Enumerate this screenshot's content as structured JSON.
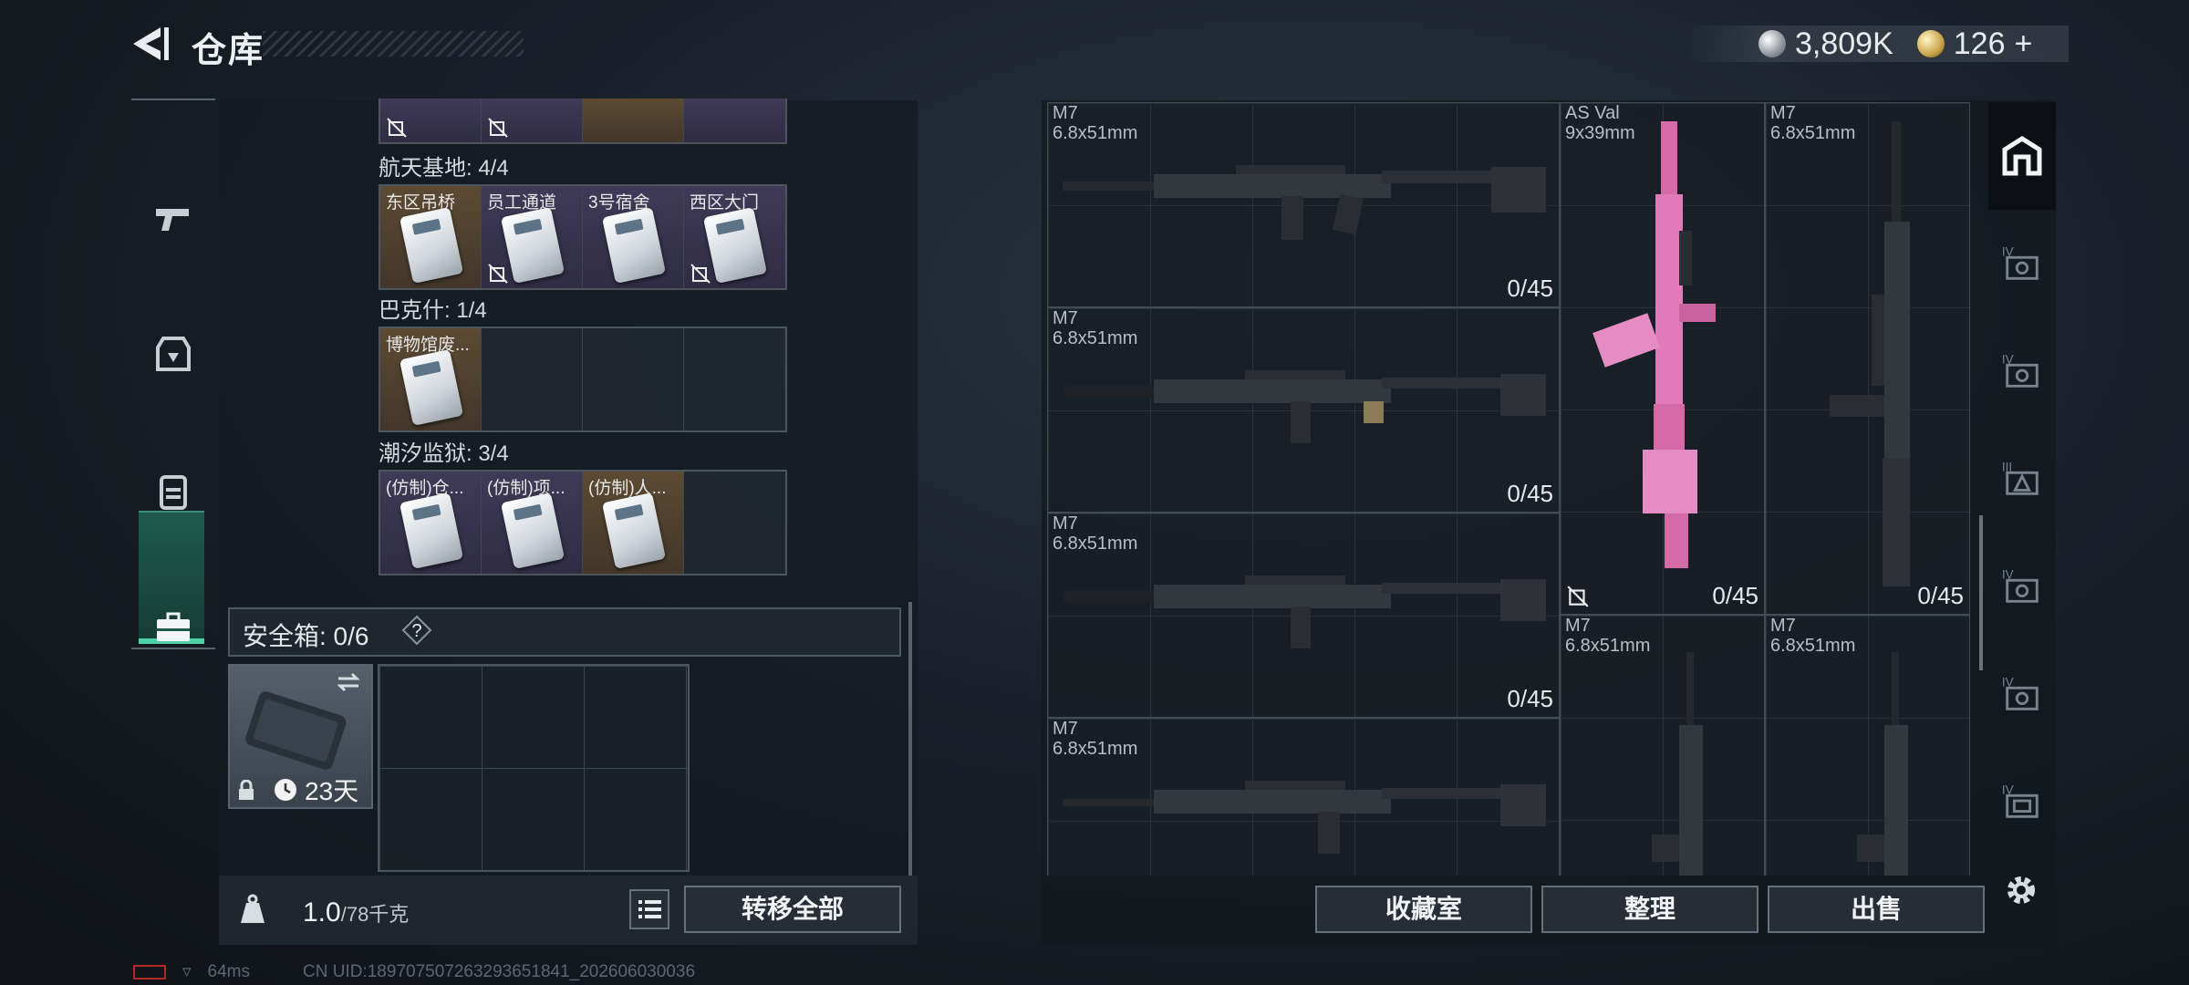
{
  "header": {
    "title": "仓库",
    "silver_amount": "3,809K",
    "gold_amount": "126",
    "gold_add": "+"
  },
  "left_panel": {
    "groups": [
      {
        "title": "航天基地: 4/4",
        "slots": [
          "东区吊桥",
          "员工通道",
          "3号宿舍",
          "西区大门"
        ]
      },
      {
        "title": "巴克什: 1/4",
        "slots": [
          "博物馆废..."
        ]
      },
      {
        "title": "潮汐监狱: 3/4",
        "slots": [
          "(仿制)仓...",
          "(仿制)项...",
          "(仿制)人..."
        ]
      }
    ],
    "safe_box": {
      "label": "安全箱: 0/6",
      "help": "?",
      "time": "23天"
    },
    "weight": {
      "current": "1.0",
      "max": "/78千克"
    },
    "transfer_all": "转移全部"
  },
  "right_panel": {
    "weapons": [
      {
        "name": "M7",
        "caliber": "6.8x51mm",
        "ammo": "0/45"
      },
      {
        "name": "M7",
        "caliber": "6.8x51mm",
        "ammo": "0/45"
      },
      {
        "name": "M7",
        "caliber": "6.8x51mm",
        "ammo": "0/45"
      },
      {
        "name": "M7",
        "caliber": "6.8x51mm",
        "ammo": ""
      },
      {
        "name": "AS Val",
        "caliber": "9x39mm",
        "ammo": "0/45"
      },
      {
        "name": "M7",
        "caliber": "6.8x51mm",
        "ammo": "0/45"
      },
      {
        "name": "M7",
        "caliber": "6.8x51mm",
        "ammo": ""
      },
      {
        "name": "M7",
        "caliber": "6.8x51mm",
        "ammo": ""
      }
    ],
    "buttons": {
      "collection": "收藏室",
      "organize": "整理",
      "sell": "出售"
    }
  },
  "status_bar": {
    "ping": "64ms",
    "uid": "CN UID:18970750726329365184​1_202606030036"
  },
  "colors": {
    "accent": "#4fd1a8",
    "pink_weapon": "#e07ab8",
    "gold_slot": "#5c4a33",
    "purple_slot": "#3f3a57"
  },
  "icons": [
    "back-arrow-icon",
    "silver-coin-icon",
    "gold-coin-icon",
    "pistol-icon",
    "armor-icon",
    "backpack-icon",
    "toolbox-icon",
    "weight-icon",
    "list-icon",
    "gear-icon",
    "no-drop-icon",
    "clock-icon",
    "lock-icon",
    "swap-icon"
  ]
}
